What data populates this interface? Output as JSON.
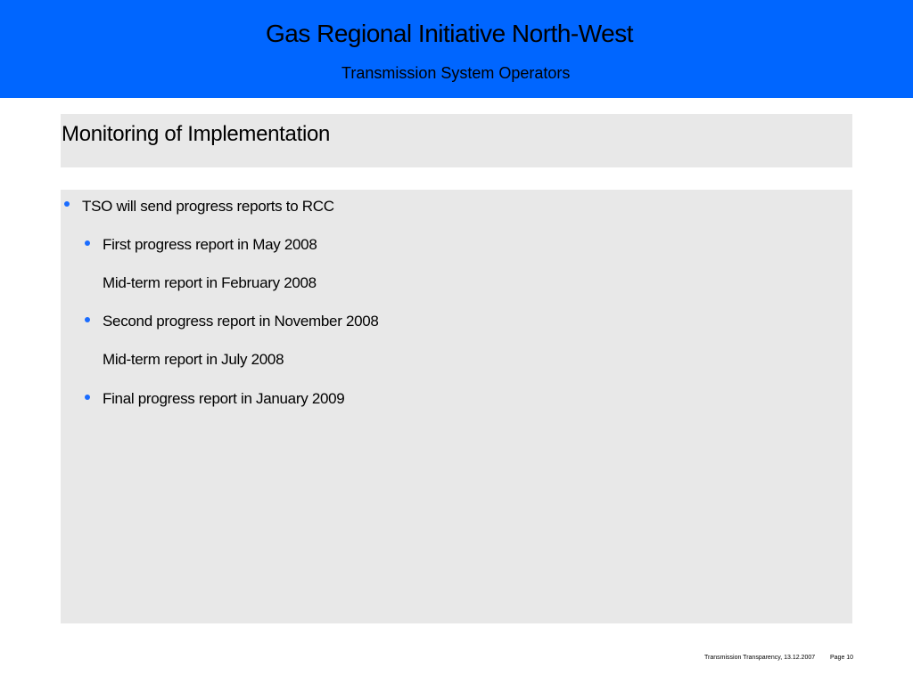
{
  "header": {
    "title": "Gas Regional Initiative North-West",
    "subtitle": "Transmission System Operators",
    "background_color": "#0066ff"
  },
  "slide": {
    "title": "Monitoring of Implementation",
    "panel_color": "#e8e8e8"
  },
  "content": {
    "bullet_color": "#1a6cff",
    "items": [
      {
        "level": 1,
        "bullet": true,
        "text": "TSO will send progress reports to RCC"
      },
      {
        "level": 2,
        "bullet": true,
        "text": "First progress report in May 2008"
      },
      {
        "level": 2,
        "bullet": false,
        "text": "Mid-term report in February 2008"
      },
      {
        "level": 2,
        "bullet": true,
        "text": "Second progress report in November 2008"
      },
      {
        "level": 2,
        "bullet": false,
        "text": "Mid-term report in July 2008"
      },
      {
        "level": 2,
        "bullet": true,
        "text": "Final progress report in January 2009"
      }
    ]
  },
  "footer": {
    "left_text": "Transmission Transparency, 13.12.2007",
    "page_text": "Page 10"
  }
}
